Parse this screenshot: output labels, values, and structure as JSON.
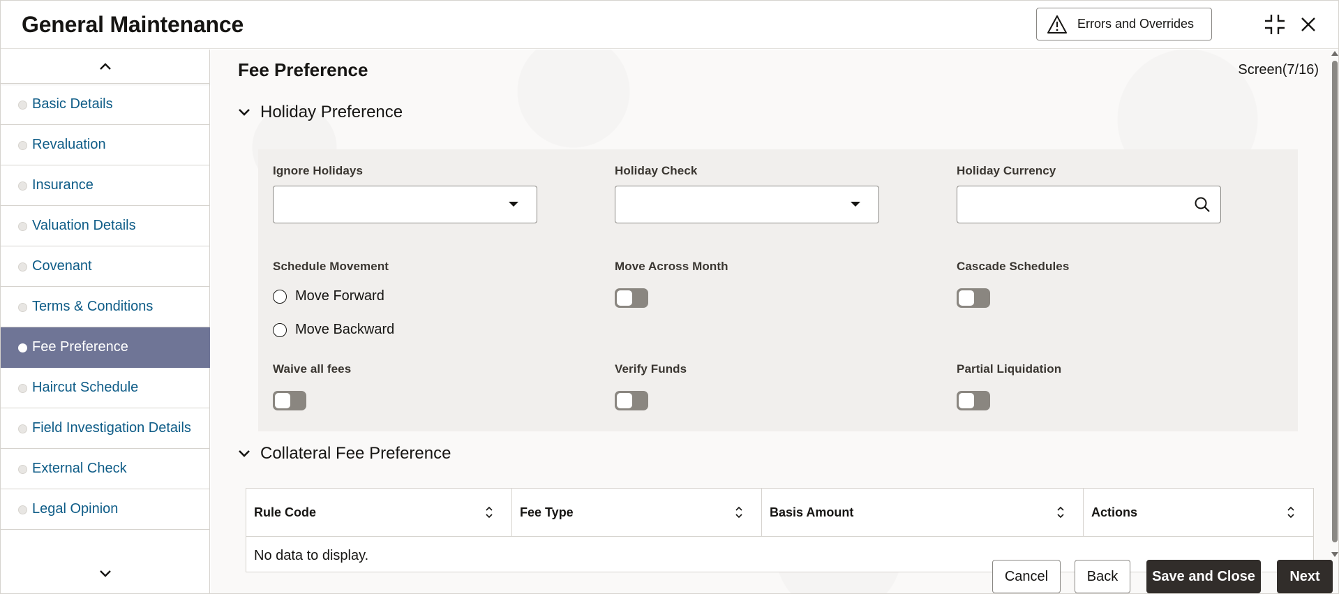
{
  "header": {
    "title": "General Maintenance",
    "errors_button": "Errors and Overrides",
    "collapse_icon": "compress-icon",
    "close_icon": "close-icon"
  },
  "sidebar": {
    "items": [
      {
        "label": "Basic Details",
        "active": false
      },
      {
        "label": "Revaluation",
        "active": false
      },
      {
        "label": "Insurance",
        "active": false
      },
      {
        "label": "Valuation Details",
        "active": false
      },
      {
        "label": "Covenant",
        "active": false
      },
      {
        "label": "Terms & Conditions",
        "active": false
      },
      {
        "label": "Fee Preference",
        "active": true
      },
      {
        "label": "Haircut Schedule",
        "active": false
      },
      {
        "label": "Field Investigation Details",
        "active": false
      },
      {
        "label": "External Check",
        "active": false
      },
      {
        "label": "Legal Opinion",
        "active": false
      }
    ],
    "active_color": "#6f7596",
    "link_color": "#0e5c87"
  },
  "main": {
    "page_title": "Fee Preference",
    "screen_counter": "Screen(7/16)",
    "holiday_section": {
      "title": "Holiday Preference",
      "ignore_holidays": {
        "label": "Ignore Holidays",
        "value": ""
      },
      "holiday_check": {
        "label": "Holiday Check",
        "value": ""
      },
      "holiday_currency": {
        "label": "Holiday Currency",
        "value": "",
        "placeholder": ""
      },
      "schedule_movement": {
        "label": "Schedule Movement",
        "options": [
          "Move Forward",
          "Move Backward"
        ],
        "selected": ""
      },
      "move_across_month": {
        "label": "Move Across Month",
        "on": false
      },
      "cascade_schedules": {
        "label": "Cascade Schedules",
        "on": false
      },
      "waive_all_fees": {
        "label": "Waive all fees",
        "on": false
      },
      "verify_funds": {
        "label": "Verify Funds",
        "on": false
      },
      "partial_liquidation": {
        "label": "Partial Liquidation",
        "on": false
      }
    },
    "collateral_section": {
      "title": "Collateral Fee Preference",
      "columns": [
        "Rule Code",
        "Fee Type",
        "Basis Amount",
        "Actions"
      ],
      "empty_text": "No data to display."
    }
  },
  "footer": {
    "cancel": "Cancel",
    "back": "Back",
    "save_close": "Save and Close",
    "next": "Next"
  }
}
